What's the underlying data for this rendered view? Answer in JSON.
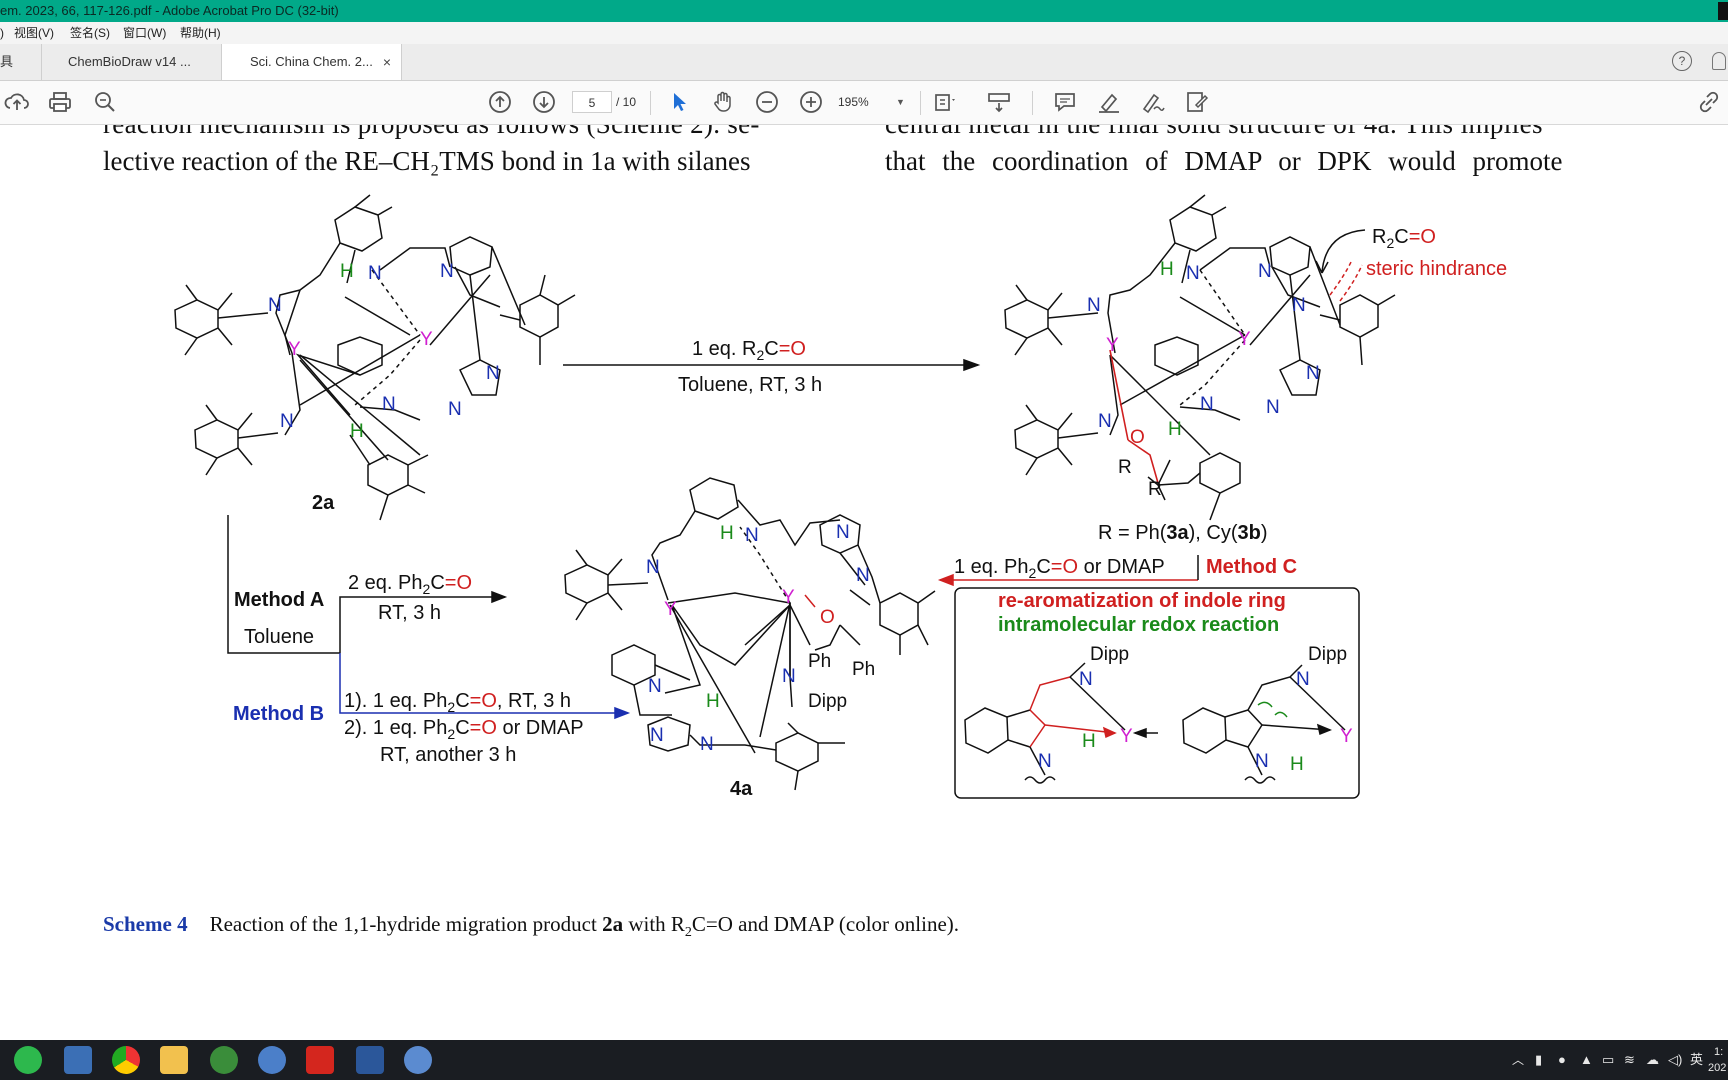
{
  "window": {
    "title": "em. 2023, 66, 117-126.pdf - Adobe Acrobat Pro DC (32-bit)"
  },
  "menu": {
    "items": [
      ")",
      "视图(V)",
      "签名(S)",
      "窗口(W)",
      "帮助(H)"
    ]
  },
  "tabs": {
    "left_label": "具",
    "items": [
      {
        "label": "ChemBioDraw v14 ..."
      },
      {
        "label": "Sci. China Chem. 2...",
        "close": "×"
      }
    ],
    "help": "?"
  },
  "toolbar": {
    "page_current": "5",
    "page_total": "/ 10",
    "zoom": "195%",
    "icons": [
      "upload-icon",
      "print-icon",
      "zoom-search-icon",
      "page-up-icon",
      "page-down-icon",
      "select-cursor-icon",
      "hand-icon",
      "zoom-out-icon",
      "zoom-in-icon",
      "fit-page-icon",
      "scroll-mode-icon",
      "comment-icon",
      "highlight-icon",
      "sign-icon",
      "fill-sign-icon",
      "share-link-icon"
    ]
  },
  "document": {
    "left_line1": "reaction mechanism is proposed as follows (Scheme 2). se-",
    "left_line2": "lective reaction of the RE–CH₂TMS bond in 1a with silanes",
    "right_line1": "central metal in the final solid structure of 4a. This implies",
    "right_line2": "that the coordination of DMAP or DPK would promote",
    "scheme": {
      "label_2a": "2a",
      "label_4a": "4a",
      "arrow_top_above_a": "1 eq. R",
      "arrow_top_above_sub": "2",
      "arrow_top_above_b": "C",
      "arrow_top_above_c": "=O",
      "arrow_top_below": "Toluene, RT, 3 h",
      "r2co_a": "R",
      "r2co_sub": "2",
      "r2co_b": "C",
      "r2co_c": "=O",
      "steric": "steric hindrance",
      "r_def_a": "R = Ph(",
      "r_def_b": "3a",
      "r_def_c": "), Cy(",
      "r_def_d": "3b",
      "r_def_e": ")",
      "method_c_cond_a": "1 eq. Ph",
      "method_c_cond_sub": "2",
      "method_c_cond_b": "C",
      "method_c_cond_c": "=O",
      "method_c_cond_d": " or DMAP",
      "method_c": "Method C",
      "method_a": "Method A",
      "toluene": "Toluene",
      "method_a_cond1_a": "2 eq. Ph",
      "method_a_cond1_sub": "2",
      "method_a_cond1_b": "C",
      "method_a_cond1_c": "=O",
      "method_a_cond2": "RT, 3 h",
      "method_b": "Method B",
      "method_b_l1_a": "1). 1 eq. Ph",
      "method_b_l1_sub": "2",
      "method_b_l1_b": "C",
      "method_b_l1_c": "=O",
      "method_b_l1_d": ", RT, 3 h",
      "method_b_l2_a": "2). 1 eq. Ph",
      "method_b_l2_sub": "2",
      "method_b_l2_b": "C",
      "method_b_l2_c": "=O",
      "method_b_l2_d": " or DMAP",
      "method_b_l3": "RT, another 3 h",
      "box_line1": "re-aromatization of indole ring",
      "box_line2": "intramolecular redox reaction",
      "dipp": "Dipp",
      "ph": "Ph",
      "atom_N": "N",
      "atom_Y": "Y",
      "atom_H": "H",
      "atom_O": "O",
      "atom_R": "R"
    },
    "caption_label": "Scheme 4",
    "caption_text_a": "Reaction of the 1,1-hydride migration product ",
    "caption_text_b": "2a",
    "caption_text_c": " with R",
    "caption_text_sub": "2",
    "caption_text_d": "C=O and DMAP (color online)."
  },
  "taskbar": {
    "apps": [
      "wechat-icon",
      "calculator-icon",
      "chrome-icon",
      "file-explorer-icon",
      "chemdraw-icon",
      "browser-icon",
      "acrobat-icon",
      "word-icon",
      "browser2-icon"
    ],
    "ime": "英",
    "clock_a": "1:",
    "clock_b": "202"
  },
  "colors": {
    "titlebar": "#01a989",
    "red": "#e02020",
    "blue": "#1a2fb0",
    "green": "#1a8a1a",
    "magenta": "#d020d0",
    "link_blue": "#1a3aa8"
  }
}
